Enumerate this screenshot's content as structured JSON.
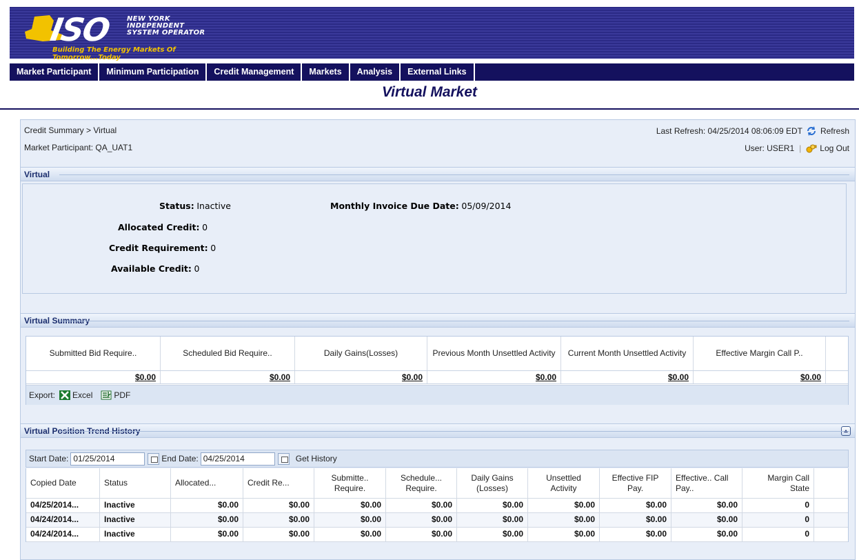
{
  "brand": {
    "line1": "NEW YORK",
    "line2": "INDEPENDENT",
    "line3": "SYSTEM OPERATOR",
    "logo": "ISO",
    "tagline": "Building The Energy Markets Of Tomorrow...Today"
  },
  "nav": [
    "Market Participant",
    "Minimum Participation",
    "Credit Management",
    "Markets",
    "Analysis",
    "External Links"
  ],
  "page_title": "Virtual Market",
  "crumb": "Credit Summary  >  Virtual",
  "market_participant": "Market Participant: QA_UAT1",
  "last_refresh": "Last Refresh: 04/25/2014 08:06:09 EDT",
  "refresh_label": "Refresh",
  "user": "User: USER1",
  "logout_label": "Log Out",
  "virtual": {
    "heading": "Virtual",
    "status_label": "Status:",
    "status_value": "Inactive",
    "invoice_label": "Monthly Invoice Due Date:",
    "invoice_value": "05/09/2014",
    "allocated_label": "Allocated Credit:",
    "allocated_value": "0",
    "requirement_label": "Credit Requirement:",
    "requirement_value": "0",
    "available_label": "Available Credit:",
    "available_value": "0"
  },
  "summary": {
    "heading": "Virtual Summary",
    "headers": [
      "Submitted Bid Require..",
      "Scheduled Bid Require..",
      "Daily Gains(Losses)",
      "Previous Month Unsettled Activity",
      "Current Month Unsettled Activity",
      "Effective Margin Call P.."
    ],
    "values": [
      "$0.00",
      "$0.00",
      "$0.00",
      "$0.00",
      "$0.00",
      "$0.00"
    ],
    "export_label": "Export:",
    "excel_label": "Excel",
    "pdf_label": "PDF"
  },
  "history": {
    "heading": "Virtual Position Trend History",
    "start_label": "Start Date:",
    "start_value": "01/25/2014",
    "end_label": "End Date:",
    "end_value": "04/25/2014",
    "get_label": "Get History",
    "headers": [
      "Copied Date",
      "Status",
      "Allocated...",
      "Credit Re...",
      "Submitte.. Require.",
      "Schedule... Require.",
      "Daily Gains (Losses)",
      "Unsettled Activity",
      "Effective FIP Pay.",
      "Effective.. Call Pay..",
      "Margin Call State"
    ],
    "rows": [
      [
        "04/25/2014...",
        "Inactive",
        "$0.00",
        "$0.00",
        "$0.00",
        "$0.00",
        "$0.00",
        "$0.00",
        "$0.00",
        "$0.00",
        "0"
      ],
      [
        "04/24/2014...",
        "Inactive",
        "$0.00",
        "$0.00",
        "$0.00",
        "$0.00",
        "$0.00",
        "$0.00",
        "$0.00",
        "$0.00",
        "0"
      ],
      [
        "04/24/2014...",
        "Inactive",
        "$0.00",
        "$0.00",
        "$0.00",
        "$0.00",
        "$0.00",
        "$0.00",
        "$0.00",
        "$0.00",
        "0"
      ]
    ]
  },
  "colors": {
    "navy": "#14115e",
    "banner": "#2b2a86",
    "accent": "#f2c200",
    "panel": "#e8eef8"
  },
  "icons": [
    "ny-state-logo",
    "refresh-icon",
    "logout-keys-icon",
    "excel-icon",
    "pdf-icon",
    "calendar-icon",
    "collapse-up-icon"
  ]
}
